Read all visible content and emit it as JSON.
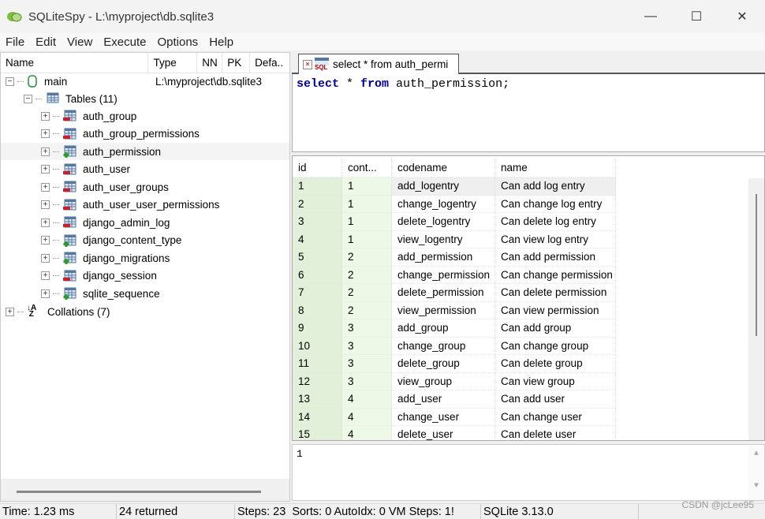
{
  "window": {
    "title": "SQLiteSpy - L:\\myproject\\db.sqlite3",
    "minimize": "—",
    "maximize": "☐",
    "close": "✕"
  },
  "menu": [
    "File",
    "Edit",
    "View",
    "Execute",
    "Options",
    "Help"
  ],
  "schema": {
    "columns": [
      "Name",
      "Type",
      "NN",
      "PK",
      "Defa.."
    ],
    "database": {
      "name": "main",
      "type": "L:\\myproject\\db.sqlite3"
    },
    "tables_label": "Tables (11)",
    "tables": [
      {
        "name": "auth_group",
        "icon": "table-minus-icon"
      },
      {
        "name": "auth_group_permissions",
        "icon": "table-minus-icon"
      },
      {
        "name": "auth_permission",
        "icon": "table-plus-icon"
      },
      {
        "name": "auth_user",
        "icon": "table-minus-icon"
      },
      {
        "name": "auth_user_groups",
        "icon": "table-minus-icon"
      },
      {
        "name": "auth_user_user_permissions",
        "icon": "table-minus-icon"
      },
      {
        "name": "django_admin_log",
        "icon": "table-minus-icon"
      },
      {
        "name": "django_content_type",
        "icon": "table-plus-icon"
      },
      {
        "name": "django_migrations",
        "icon": "table-plus-icon"
      },
      {
        "name": "django_session",
        "icon": "table-minus-icon"
      },
      {
        "name": "sqlite_sequence",
        "icon": "table-plus-icon"
      }
    ],
    "collations_label": "Collations (7)"
  },
  "editor": {
    "tab_label": "select * from auth_permi",
    "sql": {
      "kw1": "select",
      "mid": " * ",
      "kw2": "from",
      "rest": " auth_permission;"
    }
  },
  "results": {
    "columns": [
      "id",
      "cont...",
      "codename",
      "name"
    ],
    "rows": [
      [
        "1",
        "1",
        "add_logentry",
        "Can add log entry"
      ],
      [
        "2",
        "1",
        "change_logentry",
        "Can change log entry"
      ],
      [
        "3",
        "1",
        "delete_logentry",
        "Can delete log entry"
      ],
      [
        "4",
        "1",
        "view_logentry",
        "Can view log entry"
      ],
      [
        "5",
        "2",
        "add_permission",
        "Can add permission"
      ],
      [
        "6",
        "2",
        "change_permission",
        "Can change permission"
      ],
      [
        "7",
        "2",
        "delete_permission",
        "Can delete permission"
      ],
      [
        "8",
        "2",
        "view_permission",
        "Can view permission"
      ],
      [
        "9",
        "3",
        "add_group",
        "Can add group"
      ],
      [
        "10",
        "3",
        "change_group",
        "Can change group"
      ],
      [
        "11",
        "3",
        "delete_group",
        "Can delete group"
      ],
      [
        "12",
        "3",
        "view_group",
        "Can view group"
      ],
      [
        "13",
        "4",
        "add_user",
        "Can add user"
      ],
      [
        "14",
        "4",
        "change_user",
        "Can change user"
      ],
      [
        "15",
        "4",
        "delete_user",
        "Can delete user"
      ]
    ]
  },
  "output": {
    "text": "1"
  },
  "status": [
    "Time: 1.23 ms",
    "24 returned",
    "Steps: 23  Sorts: 0 AutoIdx: 0 VM Steps: 1!",
    "SQLite 3.13.0",
    ""
  ],
  "watermark": "CSDN @jcLee95",
  "colors": {
    "id_cell": "#e2efd9",
    "cont_cell": "#eef8e6",
    "selected_row": "#efefef",
    "keyword": "#000090"
  }
}
